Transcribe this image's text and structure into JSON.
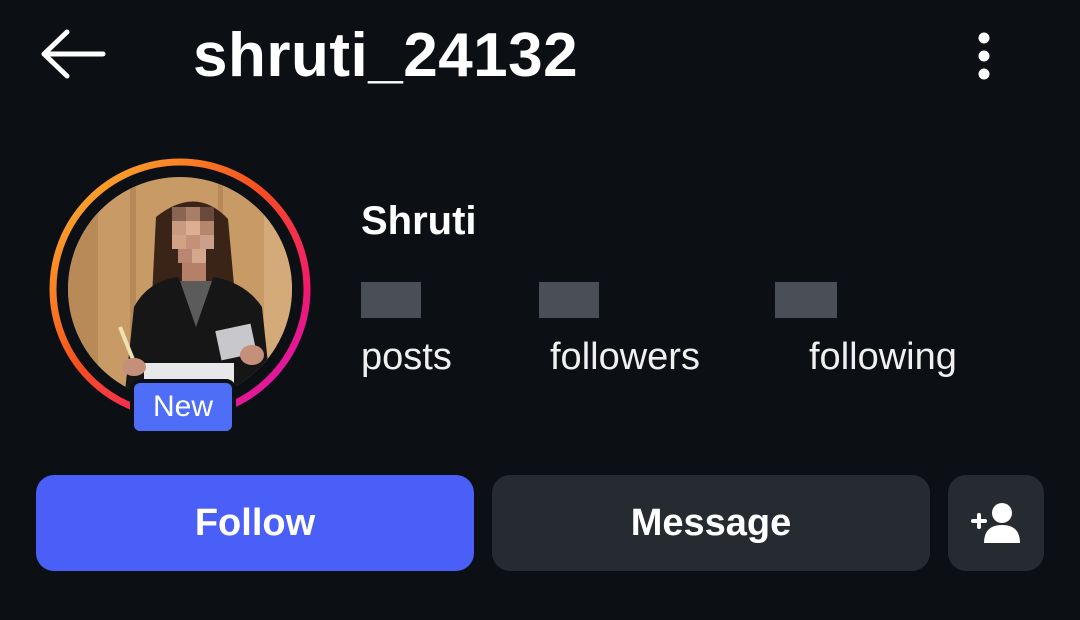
{
  "header": {
    "username": "shruti_24132",
    "back_icon": "arrow-left-icon",
    "more_icon": "more-vertical-icon"
  },
  "profile": {
    "display_name": "Shruti",
    "new_badge": "New",
    "story_ring_colors": [
      "#f9a51c",
      "#f5206a",
      "#d417d9"
    ]
  },
  "stats": [
    {
      "label": "posts"
    },
    {
      "label": "followers"
    },
    {
      "label": "following"
    }
  ],
  "actions": {
    "follow_label": "Follow",
    "message_label": "Message",
    "add_user_icon": "person-add-icon"
  },
  "colors": {
    "background": "#0c0f14",
    "follow_button": "#4a5ff7",
    "secondary_button": "#262a31",
    "badge": "#4f6ef7"
  }
}
